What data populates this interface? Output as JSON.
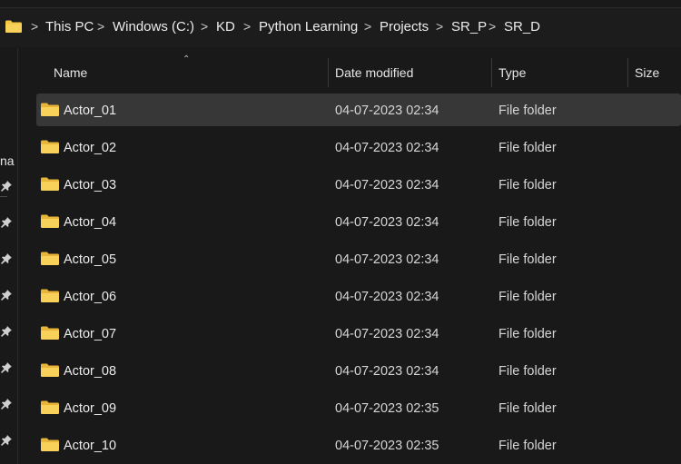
{
  "breadcrumb": {
    "items": [
      "This PC",
      "Windows (C:)",
      "KD",
      "Python Learning",
      "Projects",
      "SR_P",
      "SR_D"
    ],
    "separator": ">"
  },
  "nav": {
    "partial_label": "na"
  },
  "columns": {
    "name": "Name",
    "date_modified": "Date modified",
    "type": "Type",
    "size": "Size"
  },
  "rows": [
    {
      "name": "Actor_01",
      "date": "04-07-2023 02:34",
      "type": "File folder",
      "selected": true
    },
    {
      "name": "Actor_02",
      "date": "04-07-2023 02:34",
      "type": "File folder"
    },
    {
      "name": "Actor_03",
      "date": "04-07-2023 02:34",
      "type": "File folder"
    },
    {
      "name": "Actor_04",
      "date": "04-07-2023 02:34",
      "type": "File folder"
    },
    {
      "name": "Actor_05",
      "date": "04-07-2023 02:34",
      "type": "File folder"
    },
    {
      "name": "Actor_06",
      "date": "04-07-2023 02:34",
      "type": "File folder"
    },
    {
      "name": "Actor_07",
      "date": "04-07-2023 02:34",
      "type": "File folder"
    },
    {
      "name": "Actor_08",
      "date": "04-07-2023 02:34",
      "type": "File folder"
    },
    {
      "name": "Actor_09",
      "date": "04-07-2023 02:35",
      "type": "File folder"
    },
    {
      "name": "Actor_10",
      "date": "04-07-2023 02:35",
      "type": "File folder"
    }
  ],
  "colors": {
    "background": "#191919",
    "selected_row": "#373737",
    "folder": "#f4c542"
  },
  "icons": {
    "breadcrumb": "folder-icon",
    "rows": "folder-icon",
    "nav": "pin-icon",
    "sort": "sort-ascending-icon"
  }
}
